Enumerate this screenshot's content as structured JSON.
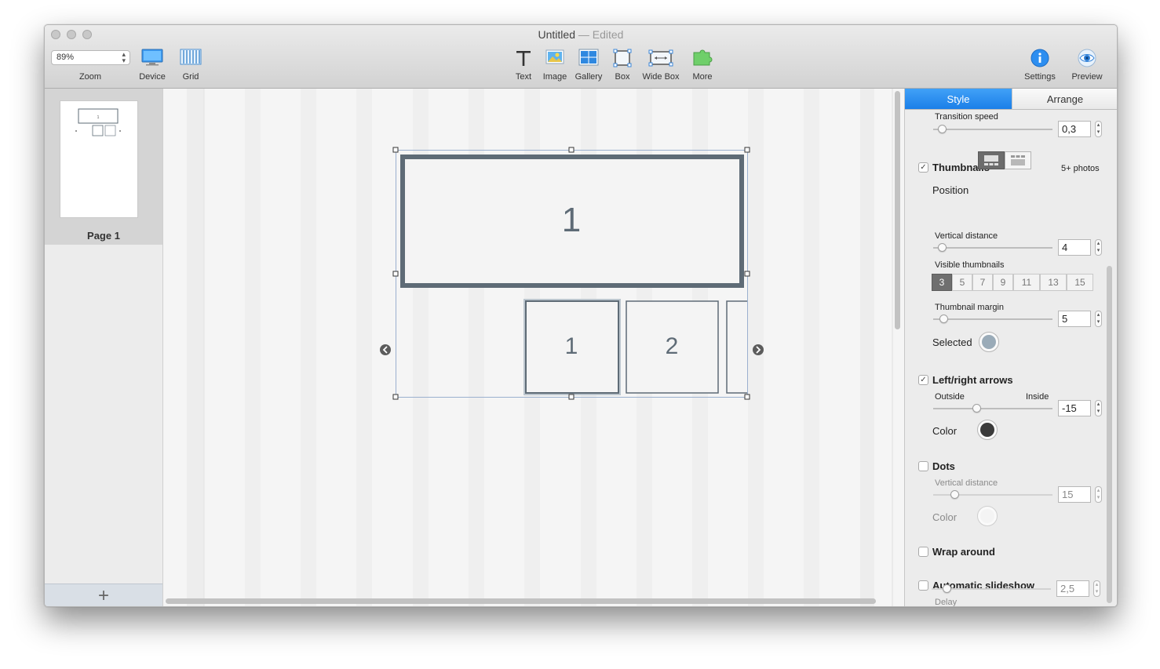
{
  "window": {
    "title": "Untitled",
    "title_sep": "—",
    "status": "Edited"
  },
  "toolbar": {
    "zoom_value": "89%",
    "items": [
      {
        "label": "Zoom"
      },
      {
        "label": "Device"
      },
      {
        "label": "Grid"
      },
      {
        "label": "Text"
      },
      {
        "label": "Image"
      },
      {
        "label": "Gallery"
      },
      {
        "label": "Box"
      },
      {
        "label": "Wide Box"
      },
      {
        "label": "More"
      },
      {
        "label": "Settings"
      },
      {
        "label": "Preview"
      }
    ]
  },
  "sidebar": {
    "pages": [
      {
        "label": "Page 1"
      }
    ],
    "add_label": "+"
  },
  "canvas": {
    "main_slide_label": "1",
    "thumbnails": [
      "1",
      "2"
    ]
  },
  "inspector": {
    "tabs": [
      {
        "label": "Style"
      },
      {
        "label": "Arrange"
      }
    ],
    "transition_speed": {
      "label": "Transition speed",
      "value": "0,3",
      "fraction": 0.07
    },
    "thumbnails": {
      "label": "Thumbnails",
      "checked": true,
      "note": "5+ photos",
      "position_label": "Position",
      "vertical_distance": {
        "label": "Vertical distance",
        "value": "4",
        "fraction": 0.04
      },
      "visible_label": "Visible thumbnails",
      "visible_options": [
        "3",
        "5",
        "7",
        "9",
        "11",
        "13",
        "15"
      ],
      "visible_selected": "3",
      "margin": {
        "label": "Thumbnail margin",
        "value": "5",
        "fraction": 0.09
      },
      "selected_label": "Selected",
      "selected_color": "#9aabb8"
    },
    "arrows": {
      "label": "Left/right arrows",
      "checked": true,
      "outside_label": "Outside",
      "inside_label": "Inside",
      "value": "-15",
      "fraction": 0.37,
      "color_label": "Color",
      "color": "#3b3b3b"
    },
    "dots": {
      "label": "Dots",
      "checked": false,
      "vertical_distance": {
        "label": "Vertical distance",
        "value": "15",
        "fraction": 0.17
      },
      "color_label": "Color",
      "color": "#f4f4f4"
    },
    "wrap_around": {
      "label": "Wrap around",
      "checked": false
    },
    "slideshow": {
      "label": "Automatic slideshow",
      "checked": false,
      "delay_label": "Delay",
      "delay_value": "2,5",
      "fraction": 0.11
    }
  },
  "colors": {
    "accent": "#1b7fe8",
    "frame": "#5e6b76",
    "check": "✓"
  }
}
